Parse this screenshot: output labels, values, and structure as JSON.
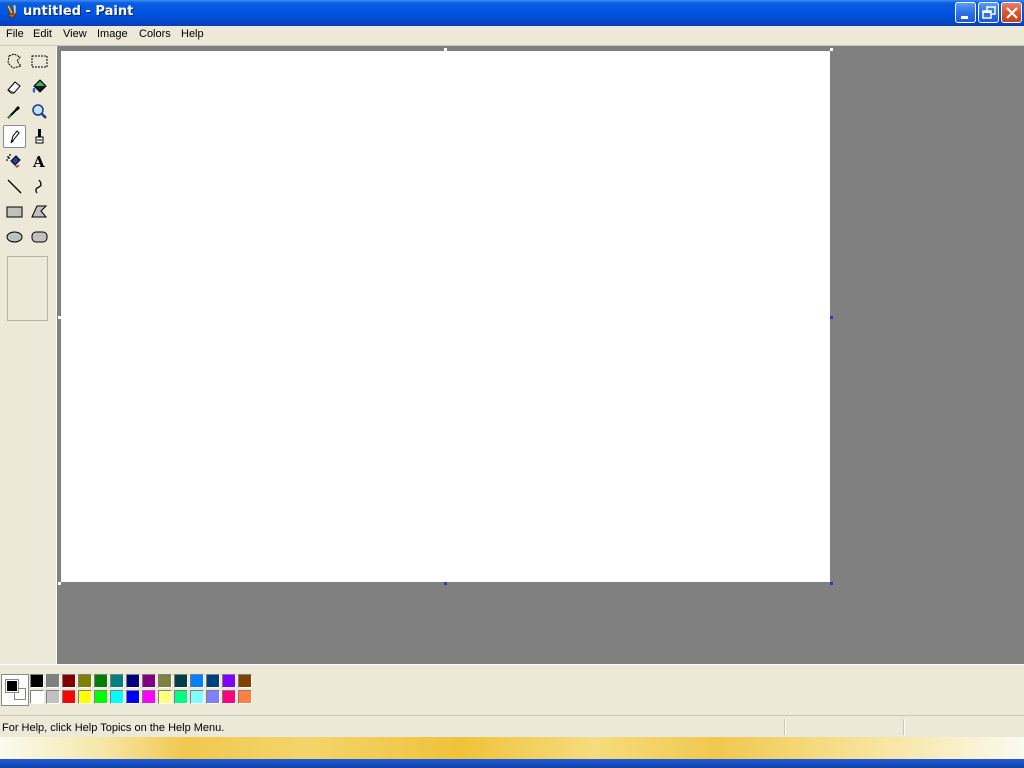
{
  "window": {
    "title": "untitled - Paint",
    "buttons": [
      "minimize-icon",
      "restore-icon",
      "close-icon"
    ]
  },
  "menubar": {
    "items": [
      {
        "label": "File"
      },
      {
        "label": "Edit"
      },
      {
        "label": "View"
      },
      {
        "label": "Image"
      },
      {
        "label": "Colors"
      },
      {
        "label": "Help"
      }
    ]
  },
  "toolbox": {
    "tools": [
      {
        "name": "free-form-select-icon"
      },
      {
        "name": "select-icon"
      },
      {
        "name": "eraser-icon"
      },
      {
        "name": "fill-with-color-icon"
      },
      {
        "name": "pick-color-icon"
      },
      {
        "name": "magnifier-icon"
      },
      {
        "name": "pencil-icon",
        "active": true
      },
      {
        "name": "brush-icon"
      },
      {
        "name": "airbrush-icon"
      },
      {
        "name": "text-icon",
        "glyph": "A"
      },
      {
        "name": "line-icon"
      },
      {
        "name": "curve-icon"
      },
      {
        "name": "rectangle-icon"
      },
      {
        "name": "polygon-icon"
      },
      {
        "name": "ellipse-icon"
      },
      {
        "name": "rounded-rectangle-icon"
      }
    ]
  },
  "colors": {
    "foreground": "#000000",
    "background": "#ffffff",
    "palette_top": [
      "#000000",
      "#808080",
      "#800000",
      "#808000",
      "#008000",
      "#008080",
      "#000080",
      "#800080",
      "#808040",
      "#004040",
      "#0080ff",
      "#004080",
      "#8000ff",
      "#804000"
    ],
    "palette_bottom": [
      "#ffffff",
      "#c0c0c0",
      "#ff0000",
      "#ffff00",
      "#00ff00",
      "#00ffff",
      "#0000ff",
      "#ff00ff",
      "#ffff80",
      "#00ff80",
      "#80ffff",
      "#8080ff",
      "#ff0080",
      "#ff8040"
    ]
  },
  "statusbar": {
    "help_text": "For Help, click Help Topics on the Help Menu."
  }
}
